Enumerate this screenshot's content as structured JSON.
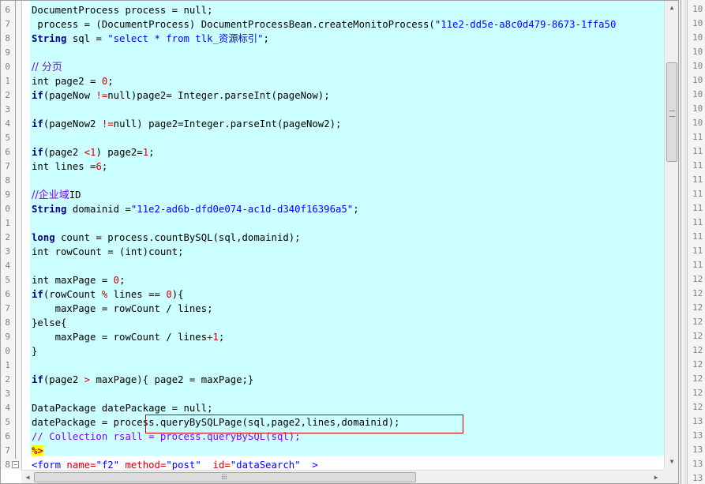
{
  "gutter": {
    "line_numbers": [
      "6",
      "7",
      "8",
      "9",
      "0",
      "1",
      "2",
      "3",
      "4",
      "5",
      "6",
      "7",
      "8",
      "9",
      "0",
      "1",
      "2",
      "3",
      "4",
      "5",
      "6",
      "7",
      "8",
      "9",
      "0",
      "1",
      "2",
      "3",
      "4",
      "5",
      "6",
      "7",
      "8"
    ]
  },
  "code": {
    "l01": {
      "a": "DocumentProcess process = null;"
    },
    "l02": {
      "a": " process = (DocumentProcess) DocumentProcessBean.createMonitoProcess(",
      "b": "\"11e2-dd5e-a8c0d479-8673-1ffa50"
    },
    "l03": {
      "a": "String",
      "b": " sql = ",
      "c": "\"select * from tlk_资源标引\"",
      "d": ";"
    },
    "l05": {
      "a": "// 分页"
    },
    "l06": {
      "a": "int page2 = ",
      "b": "0",
      "c": ";"
    },
    "l07": {
      "a": "if",
      "b": "(pageNow ",
      "c": "!=",
      "d": "null)page2= Integer.parseInt(pageNow);"
    },
    "l09": {
      "a": "if",
      "b": "(pageNow2 ",
      "c": "!=",
      "d": "null) page2=Integer.parseInt(pageNow2);"
    },
    "l11": {
      "a": "if",
      "b": "(page2 ",
      "c": "<",
      "d": "1",
      "e": ") page2=",
      "f": "1",
      "g": ";"
    },
    "l12": {
      "a": "int lines =",
      "b": "6",
      "c": ";"
    },
    "l14": {
      "a": "//企业域",
      "b": "ID"
    },
    "l15": {
      "a": "String",
      "b": " domainid =",
      "c": "\"11e2-ad6b-dfd0e074-ac1d-d340f16396a5\"",
      "d": ";"
    },
    "l17": {
      "a": "long",
      "b": " count = process.countBySQL(sql,domainid);"
    },
    "l18": {
      "a": "int rowCount = (int)count;"
    },
    "l20": {
      "a": "int maxPage = ",
      "b": "0",
      "c": ";"
    },
    "l21": {
      "a": "if",
      "b": "(rowCount ",
      "c": "%",
      "d": " lines == ",
      "e": "0",
      "f": "){"
    },
    "l22": {
      "a": "    maxPage = rowCount / lines;"
    },
    "l23": {
      "a": "}else{"
    },
    "l24": {
      "a": "    maxPage = rowCount / lines",
      "b": "+1",
      "c": ";"
    },
    "l25": {
      "a": "}"
    },
    "l27": {
      "a": "if",
      "b": "(page2 ",
      "c": ">",
      "d": " maxPage){ page2 = maxPage;}"
    },
    "l29": {
      "a": "DataPackage datePackage = null;"
    },
    "l30": {
      "a": "datePackage = ",
      "b": "process.queryBySQLPage(sql,page2,lines,domainid);"
    },
    "l31": {
      "a": "// Collection rsall = process.queryBySQL(sql);"
    },
    "l32": {
      "a": "%>"
    },
    "l33": {
      "a": "<form ",
      "b": "name=",
      "c": "\"f2\"",
      "d": " method=",
      "e": "\"post\"",
      "f": "  id=",
      "g": "\"dataSearch\"",
      "h": "  >"
    }
  },
  "rightpane": {
    "line_numbers": [
      "10",
      "10",
      "10",
      "10",
      "10",
      "10",
      "10",
      "10",
      "10",
      "11",
      "11",
      "11",
      "11",
      "11",
      "11",
      "11",
      "11",
      "11",
      "11",
      "12",
      "12",
      "12",
      "12",
      "12",
      "12",
      "12",
      "12",
      "12",
      "12",
      "13",
      "13",
      "13",
      "13",
      "13"
    ]
  },
  "colors": {
    "highlight_bg": "#ccffff",
    "keyword": "#000080",
    "string": "#0000ff",
    "comment": "#8000ff",
    "number": "#cc0000",
    "annotation_box": "#cc0000"
  }
}
